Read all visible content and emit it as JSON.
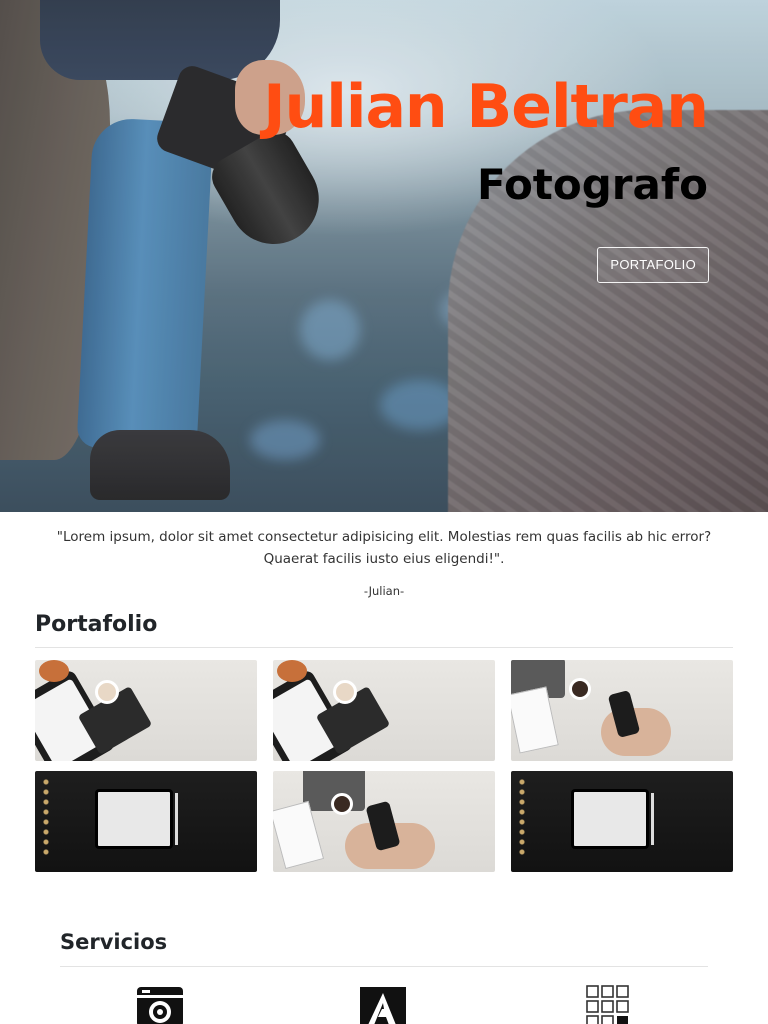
{
  "hero": {
    "name": "Julian Beltran",
    "role": "Fotografo",
    "button_label": "PORTAFOLIO",
    "name_color": "#ff4d12"
  },
  "quote": {
    "text": "\"Lorem ipsum, dolor sit amet consectetur adipisicing elit. Molestias rem quas facilis ab hic error? Quaerat facilis iusto eius eligendi!\".",
    "author": "-Julian-"
  },
  "portfolio": {
    "title": "Portafolio",
    "images": [
      {
        "icon": "tablet-keyboard-coffee-photo",
        "theme": "light"
      },
      {
        "icon": "tablet-keyboard-coffee-photo",
        "theme": "light"
      },
      {
        "icon": "hands-phone-laptop-photo",
        "theme": "light"
      },
      {
        "icon": "tablet-on-black-desk-photo",
        "theme": "dark"
      },
      {
        "icon": "hands-phone-notebook-photo",
        "theme": "light"
      },
      {
        "icon": "tablet-on-black-desk-photo",
        "theme": "dark"
      }
    ]
  },
  "services": {
    "title": "Servicios",
    "icons": [
      "camera-icon",
      "adobe-icon",
      "grid-icon"
    ]
  }
}
